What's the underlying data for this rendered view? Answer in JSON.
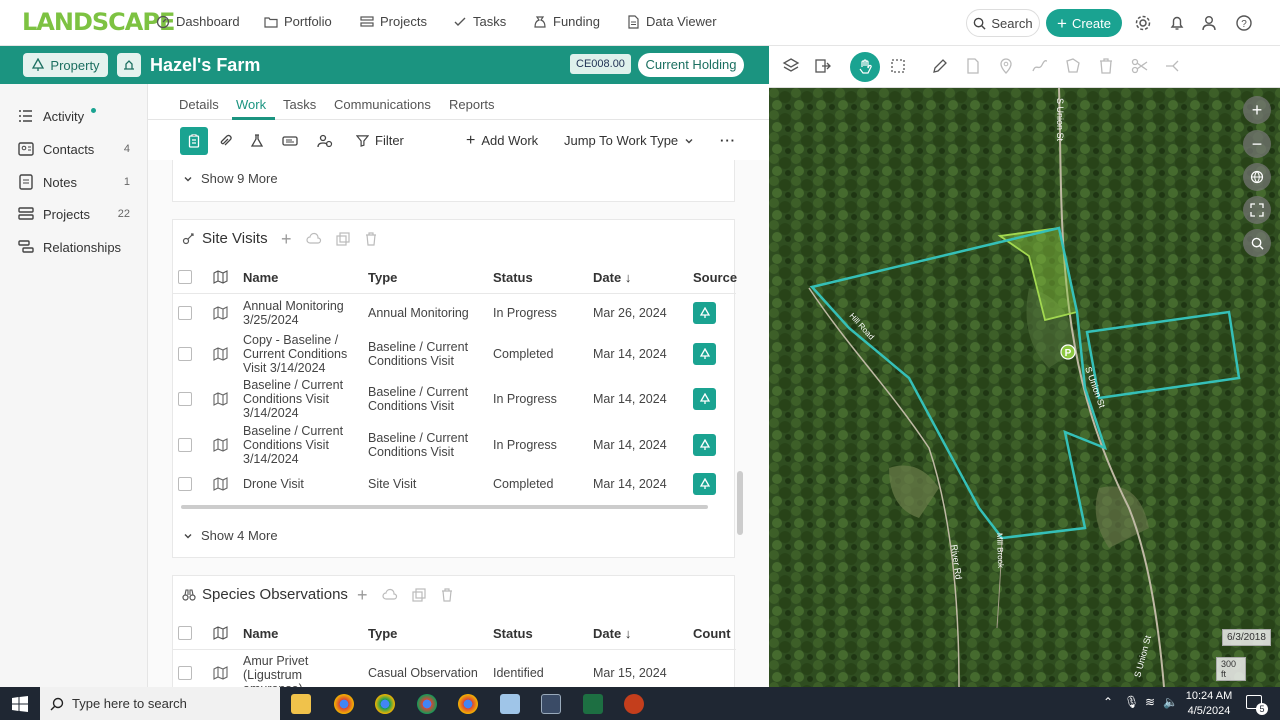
{
  "app": {
    "logo": "LANDSCAPE"
  },
  "nav": {
    "items": [
      {
        "label": "Dashboard",
        "icon": "dashboard-icon"
      },
      {
        "label": "Portfolio",
        "icon": "folder-icon"
      },
      {
        "label": "Projects",
        "icon": "projects-icon"
      },
      {
        "label": "Tasks",
        "icon": "check-icon"
      },
      {
        "label": "Funding",
        "icon": "funding-icon"
      },
      {
        "label": "Data Viewer",
        "icon": "document-icon"
      }
    ],
    "search_label": "Search",
    "create_label": "Create"
  },
  "property": {
    "type_label": "Property",
    "name": "Hazel's Farm",
    "code": "CE008.00",
    "status": "Current Holding"
  },
  "sidebar": {
    "items": [
      {
        "label": "Activity",
        "count": ""
      },
      {
        "label": "Contacts",
        "count": "4"
      },
      {
        "label": "Notes",
        "count": "1"
      },
      {
        "label": "Projects",
        "count": "22"
      },
      {
        "label": "Relationships",
        "count": ""
      }
    ]
  },
  "tabs": [
    "Details",
    "Work",
    "Tasks",
    "Communications",
    "Reports"
  ],
  "active_tab": "Work",
  "toolbar": {
    "filter_label": "Filter",
    "add_work_label": "Add Work",
    "jump_label": "Jump To Work Type"
  },
  "top_show_more": "Show 9 More",
  "site_visits": {
    "title": "Site Visits",
    "columns": [
      "Name",
      "Type",
      "Status",
      "Date",
      "Source"
    ],
    "rows": [
      {
        "name": "Annual Monitoring 3/25/2024",
        "type": "Annual Monitoring",
        "status": "In Progress",
        "date": "Mar 26, 2024"
      },
      {
        "name": "Copy - Baseline / Current Conditions Visit 3/14/2024",
        "type": "Baseline / Current Conditions Visit",
        "status": "Completed",
        "date": "Mar 14, 2024"
      },
      {
        "name": "Baseline / Current Conditions Visit 3/14/2024",
        "type": "Baseline / Current Conditions Visit",
        "status": "In Progress",
        "date": "Mar 14, 2024"
      },
      {
        "name": "Baseline / Current Conditions Visit 3/14/2024",
        "type": "Baseline / Current Conditions Visit",
        "status": "In Progress",
        "date": "Mar 14, 2024"
      },
      {
        "name": "Drone Visit",
        "type": "Site Visit",
        "status": "Completed",
        "date": "Mar 14, 2024"
      }
    ],
    "show_more": "Show 4 More"
  },
  "species": {
    "title": "Species Observations",
    "columns": [
      "Name",
      "Type",
      "Status",
      "Date",
      "Count"
    ],
    "rows": [
      {
        "name": "Amur Privet (Ligustrum amurense)",
        "type": "Casual Observation",
        "status": "Identified",
        "date": "Mar 15, 2024"
      }
    ]
  },
  "map": {
    "date": "6/3/2018",
    "scale": "300 ft",
    "road_labels": [
      "S Union St",
      "S Union St",
      "S Union St",
      "River Rd",
      "Mill Brook",
      "Hill Road"
    ],
    "parking_marker": "P"
  },
  "taskbar": {
    "search_placeholder": "Type here to search",
    "time": "10:24 AM",
    "date": "4/5/2024",
    "notification_count": "5"
  },
  "colors": {
    "accent": "#1aa391",
    "header": "#1b9480",
    "logo": "#7dc242",
    "boundary": "#35c0b8"
  }
}
